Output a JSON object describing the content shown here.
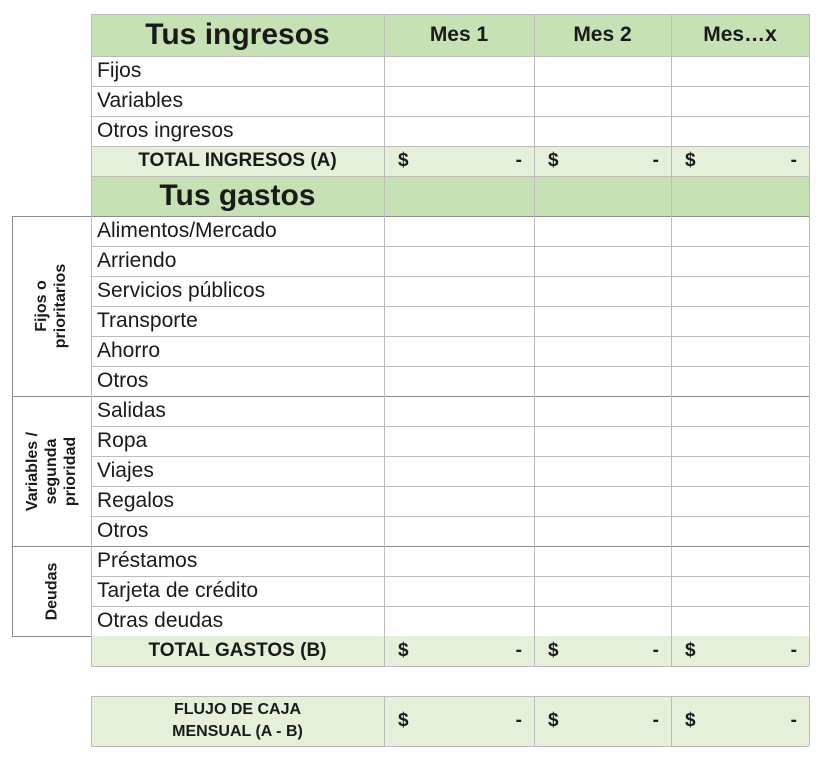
{
  "income_header": {
    "title": "Tus ingresos",
    "months": [
      "Mes 1",
      "Mes 2",
      "Mes…x"
    ]
  },
  "income_rows": [
    "Fijos",
    "Variables",
    "Otros ingresos"
  ],
  "total_income": {
    "label": "TOTAL INGRESOS (A)",
    "cells": [
      {
        "currency": "$",
        "value": "-"
      },
      {
        "currency": "$",
        "value": "-"
      },
      {
        "currency": "$",
        "value": "-"
      }
    ]
  },
  "expenses_header": {
    "title": "Tus gastos"
  },
  "expense_groups": [
    {
      "label": "Fijos o prioritarios",
      "label_lines": [
        "Fijos o",
        "prioritarios"
      ],
      "rows": [
        "Alimentos/Mercado",
        "Arriendo",
        "Servicios públicos",
        "Transporte",
        "Ahorro",
        "Otros"
      ]
    },
    {
      "label": "Variables / segunda prioridad",
      "label_lines": [
        "Variables /",
        "segunda",
        "prioridad"
      ],
      "rows": [
        "Salidas",
        "Ropa",
        "Viajes",
        "Regalos",
        "Otros"
      ]
    },
    {
      "label": "Deudas",
      "label_lines": [
        "Deudas"
      ],
      "rows": [
        "Préstamos",
        "Tarjeta de crédito",
        "Otras deudas"
      ]
    }
  ],
  "total_expenses": {
    "label": "TOTAL GASTOS (B)",
    "cells": [
      {
        "currency": "$",
        "value": "-"
      },
      {
        "currency": "$",
        "value": "-"
      },
      {
        "currency": "$",
        "value": "-"
      }
    ]
  },
  "cash_flow": {
    "label_lines": [
      "FLUJO DE CAJA",
      "MENSUAL (A - B)"
    ],
    "cells": [
      {
        "currency": "$",
        "value": "-"
      },
      {
        "currency": "$",
        "value": "-"
      },
      {
        "currency": "$",
        "value": "-"
      }
    ]
  },
  "colors": {
    "header_green": "#c6e1b4",
    "total_green": "#e4f0d9",
    "grid": "#bcbcbc"
  }
}
